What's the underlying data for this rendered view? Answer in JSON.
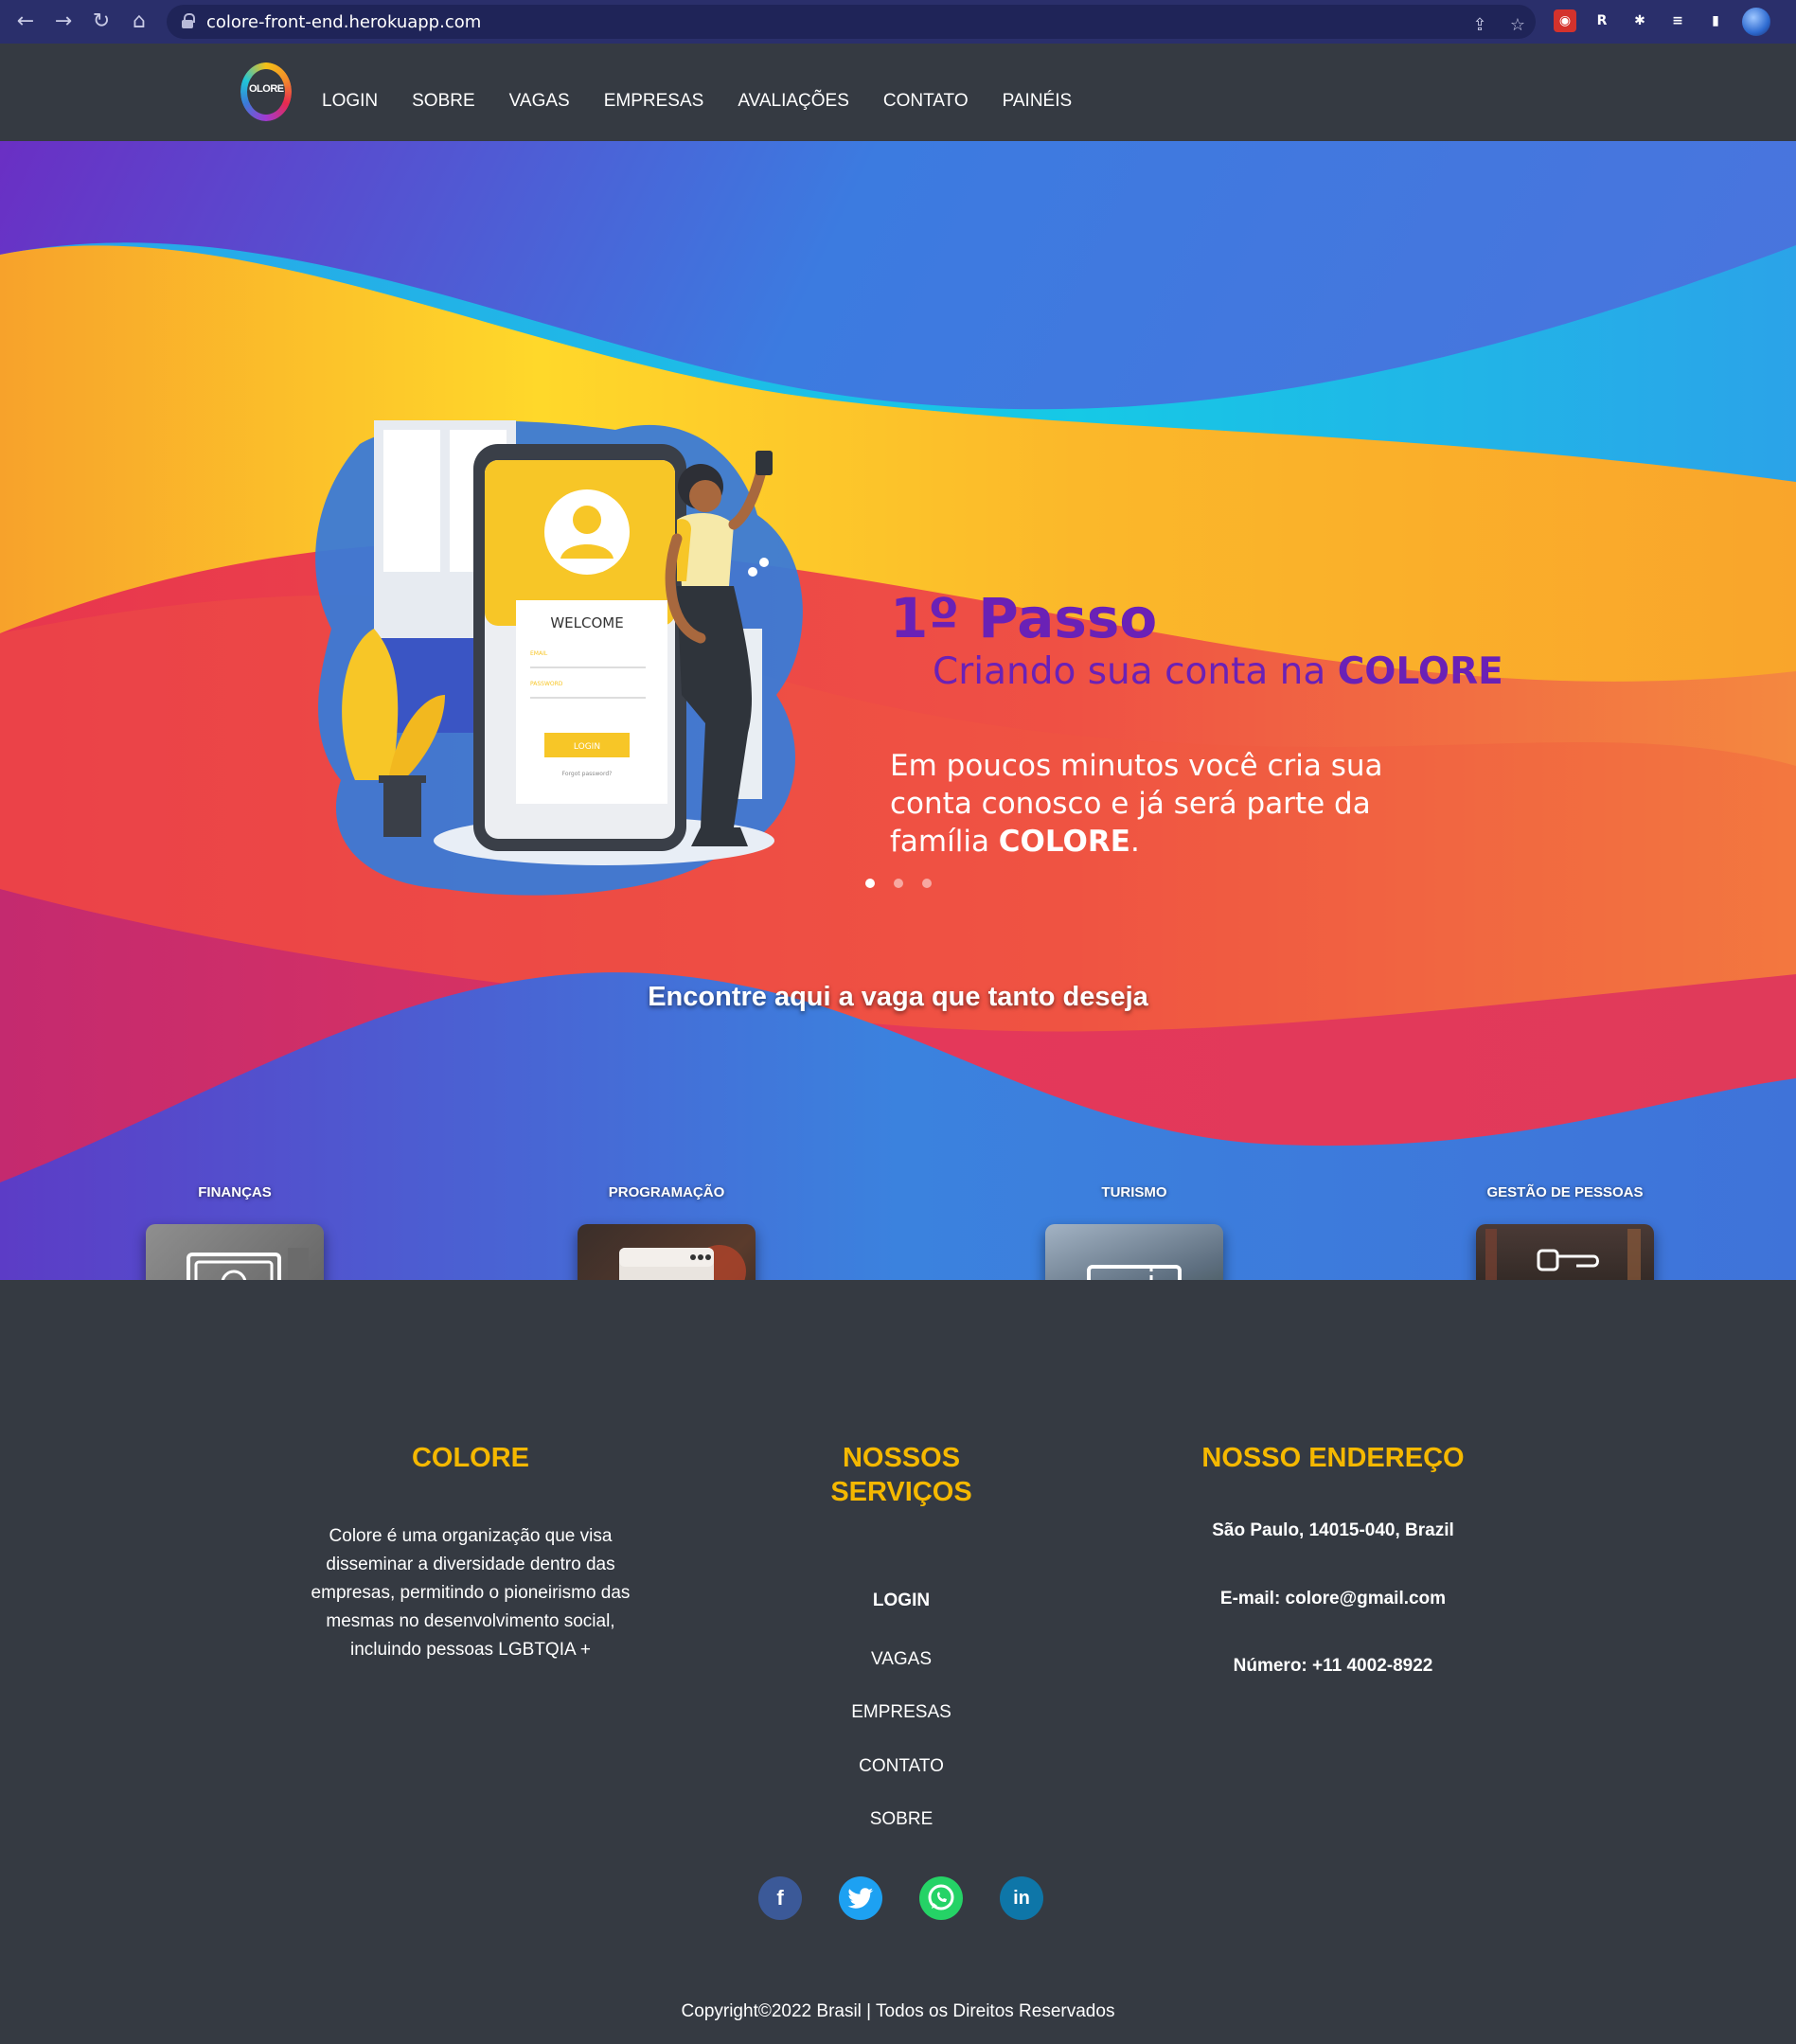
{
  "browser": {
    "url": "colore-front-end.herokuapp.com"
  },
  "nav": {
    "logo_text": "OLORE",
    "items": [
      "LOGIN",
      "SOBRE",
      "VAGAS",
      "EMPRESAS",
      "AVALIAÇÕES",
      "CONTATO",
      "PAINÉIS"
    ]
  },
  "hero": {
    "illustration": {
      "welcome": "WELCOME",
      "email_label": "EMAIL",
      "password_label": "PASSWORD",
      "login_button": "LOGIN",
      "forgot": "Forgot password?"
    },
    "slide": {
      "title": "1º Passo",
      "subtitle_prefix": "Criando sua conta na ",
      "subtitle_brand": "COLORE",
      "desc_prefix": "Em poucos minutos você cria sua conta conosco e já será parte da família ",
      "desc_brand": "COLORE",
      "desc_suffix": "."
    },
    "carousel": {
      "slides": 3,
      "active": 0
    },
    "jobs_heading": "Encontre aqui a vaga que tanto deseja",
    "categories": [
      {
        "label": "FINANÇAS",
        "icon": "money-icon"
      },
      {
        "label": "PROGRAMAÇÃO",
        "icon": "code-icon"
      },
      {
        "label": "TURISMO",
        "icon": "ticket-icon"
      },
      {
        "label": "GESTÃO DE PESSOAS",
        "icon": "people-management-icon"
      }
    ]
  },
  "footer": {
    "about": {
      "title": "COLORE",
      "text": "Colore é uma organização que visa disseminar a diversidade dentro das empresas, permitindo o pioneirismo das mesmas no desenvolvimento social, incluindo pessoas LGBTQIA +"
    },
    "services": {
      "title_line1": "NOSSOS",
      "title_line2": "SERVIÇOS",
      "links": [
        "LOGIN",
        "VAGAS",
        "EMPRESAS",
        "CONTATO",
        "SOBRE"
      ]
    },
    "address": {
      "title": "NOSSO ENDEREÇO",
      "location": "São Paulo, 14015-040, Brazil",
      "email": "E-mail: colore@gmail.com",
      "phone": "Número: +11 4002-8922"
    },
    "social": [
      {
        "name": "facebook",
        "glyph": "f",
        "color": "#3b5998"
      },
      {
        "name": "twitter",
        "glyph": "t",
        "color": "#1da1f2"
      },
      {
        "name": "whatsapp",
        "glyph": "w",
        "color": "#25d366"
      },
      {
        "name": "linkedin",
        "glyph": "in",
        "color": "#0e76a8"
      }
    ],
    "copyright": "Copyright©2022 Brasil | Todos os Direitos Reservados"
  },
  "colors": {
    "accent": "#f5b800",
    "brand_purple": "#6a21b6",
    "page_bg": "#353a42"
  }
}
